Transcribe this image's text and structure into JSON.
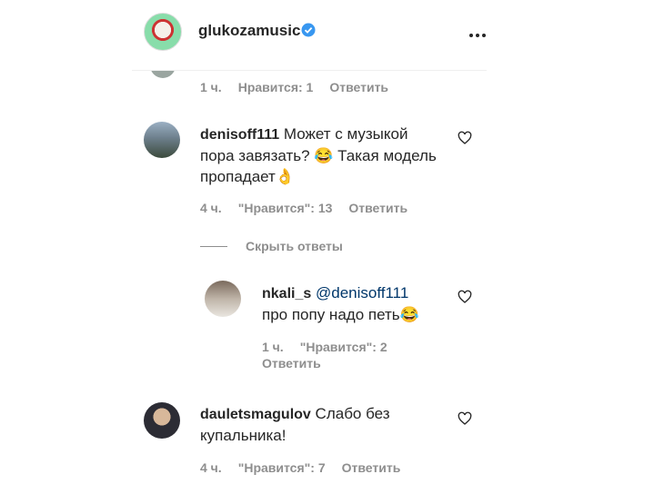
{
  "header": {
    "username": "glukozamusic"
  },
  "top_meta": {
    "time": "1 ч.",
    "likes": "Нравится: 1",
    "reply": "Ответить"
  },
  "comments": [
    {
      "username": "denisoff111",
      "line1": "Может с музыкой",
      "line2": "пора завязать? 😂 Такая модель",
      "line3": "пропадает👌",
      "time": "4 ч.",
      "likes": "\"Нравится\": 13",
      "reply": "Ответить"
    },
    {
      "username": "dauletsmagulov",
      "line1": "Слабо без",
      "line2": "купальника!",
      "time": "4 ч.",
      "likes": "\"Нравится\": 7",
      "reply": "Ответить"
    }
  ],
  "hide_replies": "Скрыть ответы",
  "reply_comment": {
    "username": "nkali_s",
    "mention": "@denisoff111",
    "line2": "про попу надо петь😂",
    "time": "1 ч.",
    "likes": "\"Нравится\": 2",
    "reply": "Ответить"
  },
  "colors": {
    "verified": "#3897f0",
    "meta": "#8e8e8e",
    "mention": "#00376b"
  }
}
